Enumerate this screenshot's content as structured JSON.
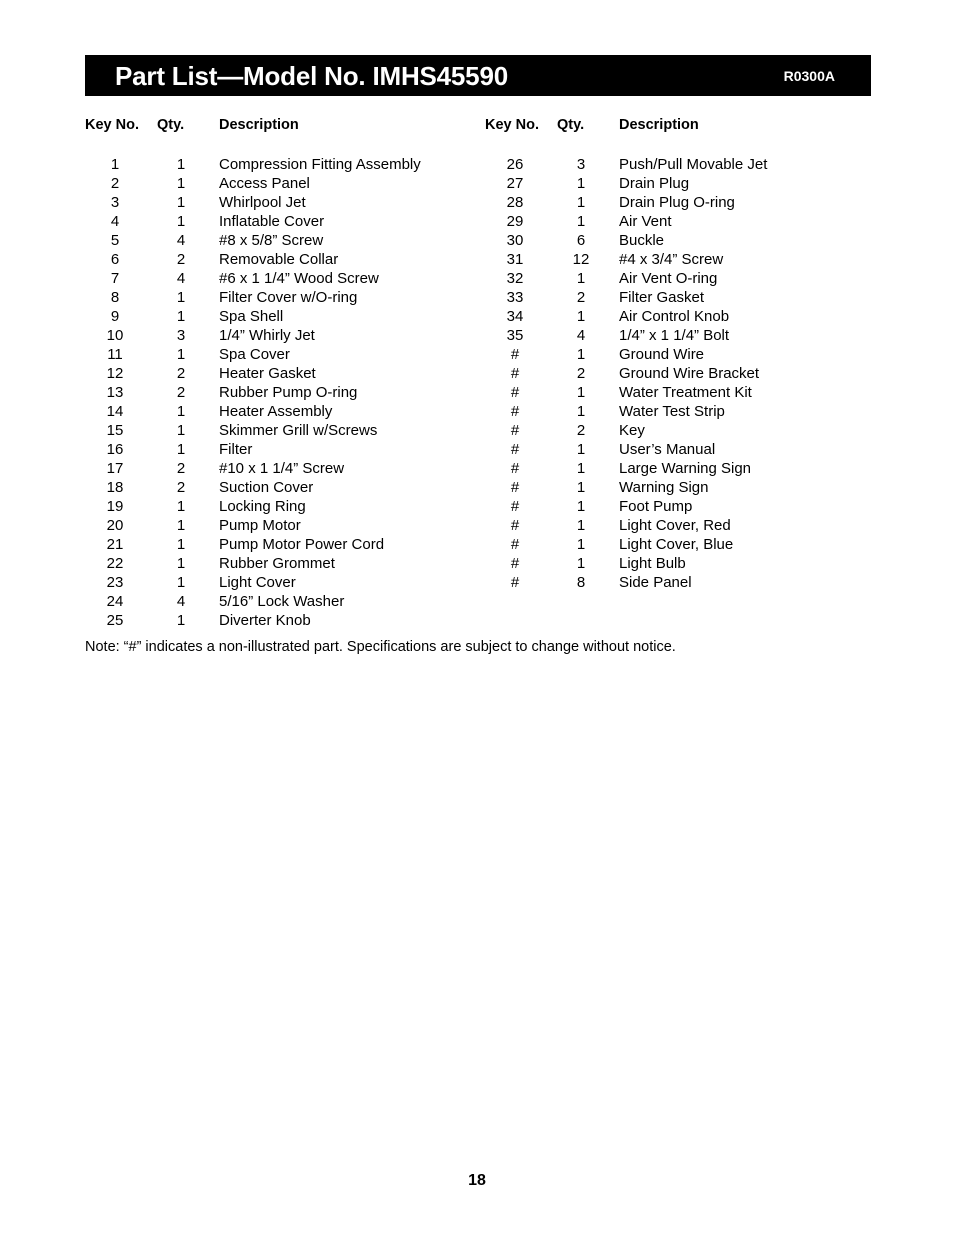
{
  "header": {
    "title": "Part List—Model No. IMHS45590",
    "revision_code": "R0300A",
    "background_color": "#000000",
    "text_color": "#ffffff"
  },
  "table": {
    "columns": [
      {
        "headers": {
          "key_no": "Key No.",
          "qty": "Qty.",
          "description": "Description"
        },
        "rows": [
          {
            "key_no": "1",
            "qty": "1",
            "description": "Compression Fitting Assembly"
          },
          {
            "key_no": "2",
            "qty": "1",
            "description": "Access Panel"
          },
          {
            "key_no": "3",
            "qty": "1",
            "description": "Whirlpool Jet"
          },
          {
            "key_no": "4",
            "qty": "1",
            "description": "Inflatable Cover"
          },
          {
            "key_no": "5",
            "qty": "4",
            "description": "#8 x 5/8” Screw"
          },
          {
            "key_no": "6",
            "qty": "2",
            "description": "Removable Collar"
          },
          {
            "key_no": "7",
            "qty": "4",
            "description": "#6 x 1 1/4” Wood Screw"
          },
          {
            "key_no": "8",
            "qty": "1",
            "description": "Filter Cover w/O-ring"
          },
          {
            "key_no": "9",
            "qty": "1",
            "description": "Spa Shell"
          },
          {
            "key_no": "10",
            "qty": "3",
            "description": "1/4” Whirly Jet"
          },
          {
            "key_no": "11",
            "qty": "1",
            "description": "Spa Cover"
          },
          {
            "key_no": "12",
            "qty": "2",
            "description": "Heater Gasket"
          },
          {
            "key_no": "13",
            "qty": "2",
            "description": "Rubber Pump O-ring"
          },
          {
            "key_no": "14",
            "qty": "1",
            "description": "Heater Assembly"
          },
          {
            "key_no": "15",
            "qty": "1",
            "description": "Skimmer Grill w/Screws"
          },
          {
            "key_no": "16",
            "qty": "1",
            "description": "Filter"
          },
          {
            "key_no": "17",
            "qty": "2",
            "description": "#10 x 1 1/4” Screw"
          },
          {
            "key_no": "18",
            "qty": "2",
            "description": "Suction Cover"
          },
          {
            "key_no": "19",
            "qty": "1",
            "description": "Locking Ring"
          },
          {
            "key_no": "20",
            "qty": "1",
            "description": "Pump Motor"
          },
          {
            "key_no": "21",
            "qty": "1",
            "description": "Pump Motor Power Cord"
          },
          {
            "key_no": "22",
            "qty": "1",
            "description": "Rubber Grommet"
          },
          {
            "key_no": "23",
            "qty": "1",
            "description": "Light Cover"
          },
          {
            "key_no": "24",
            "qty": "4",
            "description": "5/16” Lock Washer"
          },
          {
            "key_no": "25",
            "qty": "1",
            "description": "Diverter Knob"
          }
        ]
      },
      {
        "headers": {
          "key_no": "Key No.",
          "qty": "Qty.",
          "description": "Description"
        },
        "rows": [
          {
            "key_no": "26",
            "qty": "3",
            "description": "Push/Pull Movable Jet"
          },
          {
            "key_no": "27",
            "qty": "1",
            "description": "Drain Plug"
          },
          {
            "key_no": "28",
            "qty": "1",
            "description": "Drain Plug O-ring"
          },
          {
            "key_no": "29",
            "qty": "1",
            "description": "Air Vent"
          },
          {
            "key_no": "30",
            "qty": "6",
            "description": "Buckle"
          },
          {
            "key_no": "31",
            "qty": "12",
            "description": "#4 x 3/4” Screw"
          },
          {
            "key_no": "32",
            "qty": "1",
            "description": "Air Vent O-ring"
          },
          {
            "key_no": "33",
            "qty": "2",
            "description": "Filter Gasket"
          },
          {
            "key_no": "34",
            "qty": "1",
            "description": "Air Control Knob"
          },
          {
            "key_no": "35",
            "qty": "4",
            "description": "1/4” x 1 1/4” Bolt"
          },
          {
            "key_no": "#",
            "qty": "1",
            "description": "Ground Wire"
          },
          {
            "key_no": "#",
            "qty": "2",
            "description": "Ground Wire Bracket"
          },
          {
            "key_no": "#",
            "qty": "1",
            "description": "Water Treatment Kit"
          },
          {
            "key_no": "#",
            "qty": "1",
            "description": "Water Test Strip"
          },
          {
            "key_no": "#",
            "qty": "2",
            "description": "Key"
          },
          {
            "key_no": "#",
            "qty": "1",
            "description": "User’s Manual"
          },
          {
            "key_no": "#",
            "qty": "1",
            "description": "Large Warning Sign"
          },
          {
            "key_no": "#",
            "qty": "1",
            "description": "Warning Sign"
          },
          {
            "key_no": "#",
            "qty": "1",
            "description": "Foot Pump"
          },
          {
            "key_no": "#",
            "qty": "1",
            "description": "Light Cover, Red"
          },
          {
            "key_no": "#",
            "qty": "1",
            "description": "Light Cover, Blue"
          },
          {
            "key_no": "#",
            "qty": "1",
            "description": "Light Bulb"
          },
          {
            "key_no": "#",
            "qty": "8",
            "description": "Side Panel"
          }
        ]
      }
    ]
  },
  "note": "Note: “#” indicates a non-illustrated part. Specifications are subject to change without notice.",
  "page_number": "18"
}
